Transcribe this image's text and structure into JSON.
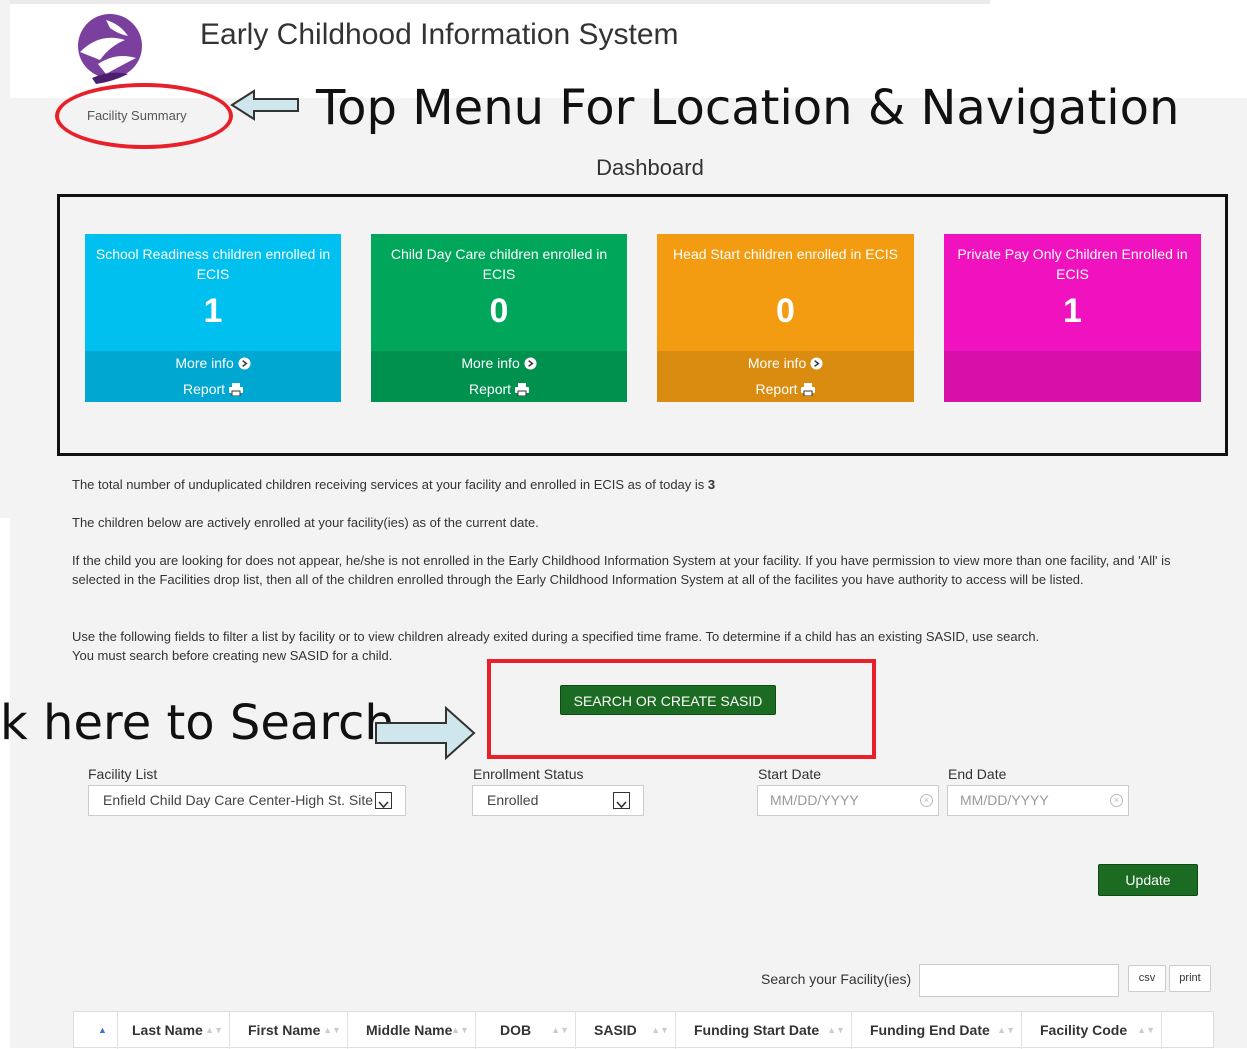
{
  "header": {
    "app_title": "Early Childhood Information System"
  },
  "breadcrumb": {
    "current": "Facility Summary"
  },
  "annotations": {
    "top_menu": "Top Menu For Location & Navigation",
    "search": "k here to Search"
  },
  "dashboard": {
    "title": "Dashboard",
    "tiles": [
      {
        "title": "School Readiness children enrolled in ECIS",
        "count": "1",
        "more_info": "More info",
        "report": "Report",
        "color": "#00c0ef",
        "footer_color": "#00a7d0"
      },
      {
        "title": "Child Day Care children enrolled in ECIS",
        "count": "0",
        "more_info": "More info",
        "report": "Report",
        "color": "#00a65a",
        "footer_color": "#00914f"
      },
      {
        "title": "Head Start children enrolled in ECIS",
        "count": "0",
        "more_info": "More info",
        "report": "Report",
        "color": "#f39c12",
        "footer_color": "#da8c10"
      },
      {
        "title": "Private Pay Only Children Enrolled in ECIS",
        "count": "1",
        "color": "#f012be",
        "footer_color": "#d810aa"
      }
    ]
  },
  "info": {
    "total_text": "The total number of unduplicated children receiving services at your facility and enrolled in ECIS as of today is",
    "total_count": "3",
    "enrolled_text": "The children below are actively enrolled at your facility(ies) as of the current date.",
    "not_appear_text": "If the child you are looking for does not appear, he/she is not enrolled in the Early Childhood Information System at your facility. If you have permission to view more than one facility, and 'All' is selected in the Facilities drop list, then all of the children enrolled through the Early Childhood Information System at all of the facilites you have authority to access will be listed.",
    "filter_text_1": "Use the following fields to filter a list by facility or to view children already exited during a specified time frame. To determine if a child has an existing SASID, use search.",
    "filter_text_2": "You must search before creating new SASID for a child."
  },
  "search_button": "SEARCH OR CREATE SASID",
  "filters": {
    "facility_label": "Facility List",
    "facility_value": "Enfield Child Day Care Center-High St. Site",
    "status_label": "Enrollment Status",
    "status_value": "Enrolled",
    "start_label": "Start Date",
    "start_placeholder": "MM/DD/YYYY",
    "end_label": "End Date",
    "end_placeholder": "MM/DD/YYYY"
  },
  "update_button": "Update",
  "table_search": {
    "label": "Search your Facility(ies)",
    "csv": "csv",
    "print": "print"
  },
  "table": {
    "columns": [
      "Last Name",
      "First Name",
      "Middle Name",
      "DOB",
      "SASID",
      "Funding Start Date",
      "Funding End Date",
      "Facility Code"
    ]
  }
}
